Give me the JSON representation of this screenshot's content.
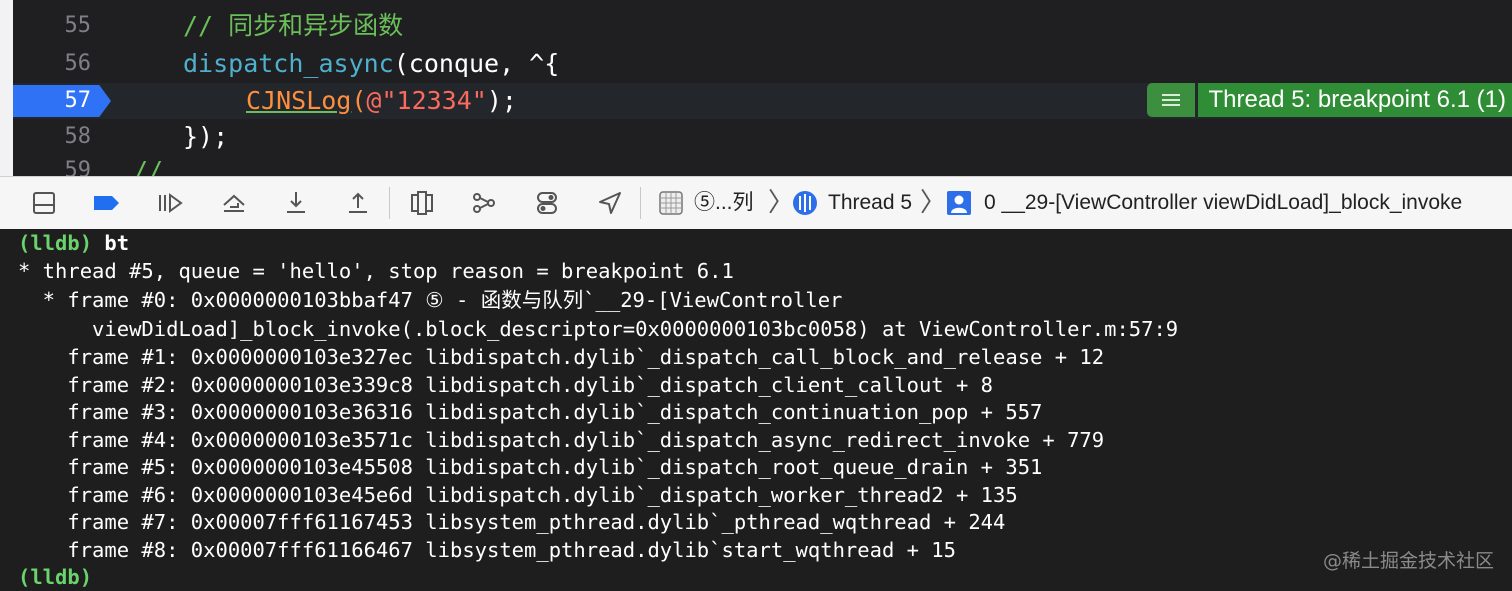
{
  "editor": {
    "lines": [
      {
        "num": "55",
        "comment": "// 同步和异步函数"
      },
      {
        "num": "56",
        "func": "dispatch_async",
        "rest": "(conque, ^{"
      },
      {
        "num": "57",
        "macro": "CJNSLog",
        "open": "(",
        "str": "@\"12334\"",
        "close": ");"
      },
      {
        "num": "58",
        "text": "});"
      },
      {
        "num": "59",
        "comment": "//"
      }
    ],
    "breakpoint_label": "Thread 5: breakpoint 6.1 (1)"
  },
  "toolbar": {
    "buttons": [
      "hide-debug-area-icon",
      "breakpoints-toggle-icon",
      "continue-icon",
      "step-over-icon",
      "step-into-icon",
      "step-out-icon",
      "view-hierarchy-icon",
      "memory-graph-icon",
      "environment-overrides-icon",
      "simulate-location-icon"
    ],
    "crumb_app": "⑤...列",
    "crumb_thread": "Thread 5",
    "crumb_frame": "0 __29-[ViewController viewDidLoad]_block_invoke"
  },
  "console": {
    "lines": [
      {
        "prompt": "(lldb)",
        "cmd": " bt"
      },
      {
        "text": "* thread #5, queue = 'hello', stop reason = breakpoint 6.1"
      },
      {
        "text": "  * frame #0: 0x0000000103bbaf47 ⑤ - 函数与队列`__29-[ViewController"
      },
      {
        "text": "      viewDidLoad]_block_invoke(.block_descriptor=0x0000000103bc0058) at ViewController.m:57:9"
      },
      {
        "text": "    frame #1: 0x0000000103e327ec libdispatch.dylib`_dispatch_call_block_and_release + 12"
      },
      {
        "text": "    frame #2: 0x0000000103e339c8 libdispatch.dylib`_dispatch_client_callout + 8"
      },
      {
        "text": "    frame #3: 0x0000000103e36316 libdispatch.dylib`_dispatch_continuation_pop + 557"
      },
      {
        "text": "    frame #4: 0x0000000103e3571c libdispatch.dylib`_dispatch_async_redirect_invoke + 779"
      },
      {
        "text": "    frame #5: 0x0000000103e45508 libdispatch.dylib`_dispatch_root_queue_drain + 351"
      },
      {
        "text": "    frame #6: 0x0000000103e45e6d libdispatch.dylib`_dispatch_worker_thread2 + 135"
      },
      {
        "text": "    frame #7: 0x00007fff61167453 libsystem_pthread.dylib`_pthread_wqthread + 244"
      },
      {
        "text": "    frame #8: 0x00007fff61166467 libsystem_pthread.dylib`start_wqthread + 15"
      },
      {
        "prompt": "(lldb)",
        "cmd": ""
      }
    ],
    "watermark": "@稀土掘金技术社区"
  }
}
